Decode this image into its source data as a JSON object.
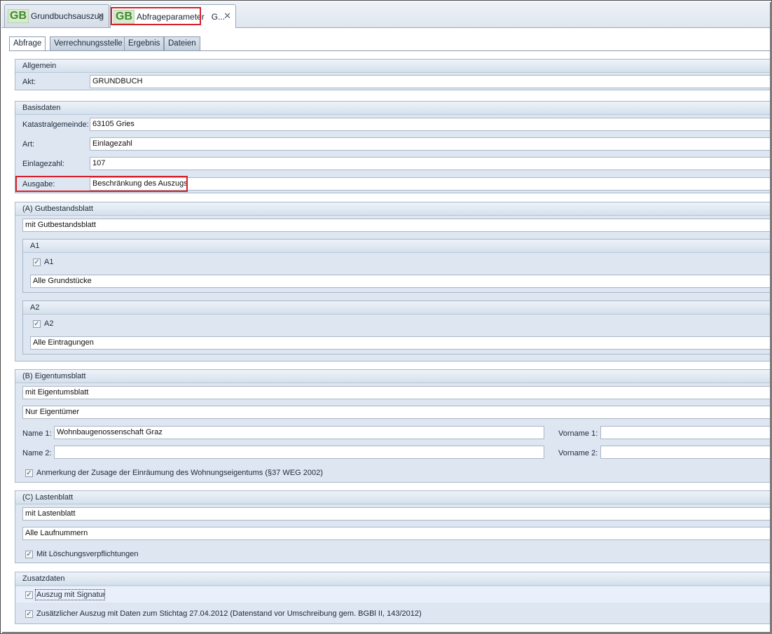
{
  "doc_tabs": [
    {
      "label": "Grundbuchsauszug",
      "icon": "gb-logo-icon",
      "close": "✕"
    },
    {
      "label": "Abfrageparameter",
      "suffix": "G...",
      "icon": "gb-logo-icon",
      "close": "✕"
    }
  ],
  "gb_logo_text": "GB",
  "inner_tabs": [
    "Abfrage",
    "Verrechnungsstelle",
    "Ergebnis",
    "Dateien"
  ],
  "allgemein": {
    "title": "Allgemein",
    "akt_label": "Akt:",
    "akt_value": "GRUNDBUCH"
  },
  "basisdaten": {
    "title": "Basisdaten",
    "kg_label": "Katastralgemeinde:",
    "kg_value": "63105 Gries",
    "art_label": "Art:",
    "art_value": "Einlagezahl",
    "ez_label": "Einlagezahl:",
    "ez_value": "107",
    "ausgabe_label": "Ausgabe:",
    "ausgabe_value": "Beschränkung des Auszugs"
  },
  "gutbestand": {
    "title": "(A) Gutbestandsblatt",
    "select": "mit Gutbestandsblatt",
    "a1": {
      "title": "A1",
      "check_label": "A1",
      "checked": true,
      "select": "Alle Grundstücke"
    },
    "a2": {
      "title": "A2",
      "check_label": "A2",
      "checked": true,
      "select": "Alle Eintragungen"
    }
  },
  "eigentum": {
    "title": "(B) Eigentumsblatt",
    "select1": "mit Eigentumsblatt",
    "select2": "Nur Eigentümer",
    "name1_label": "Name 1:",
    "name1_value": "Wohnbaugenossenschaft Graz",
    "vorname1_label": "Vorname 1:",
    "vorname1_value": "",
    "name2_label": "Name 2:",
    "name2_value": "",
    "vorname2_label": "Vorname 2:",
    "vorname2_value": "",
    "anmerkung_label": "Anmerkung der Zusage der Einräumung des Wohnungseigentums (§37 WEG 2002)",
    "anmerkung_checked": true
  },
  "lasten": {
    "title": "(C) Lastenblatt",
    "select1": "mit Lastenblatt",
    "select2": "Alle Laufnummern",
    "loesch_label": "Mit Löschungsverpflichtungen",
    "loesch_checked": true
  },
  "zusatz": {
    "title": "Zusatzdaten",
    "signatur_label": "Auszug mit Signatur",
    "signatur_checked": true,
    "stichtag_label": "Zusätzlicher Auszug mit Daten zum Stichtag 27.04.2012 (Datenstand vor Umschreibung gem. BGBl II, 143/2012)",
    "stichtag_checked": true
  },
  "check_glyph": "✓",
  "colors": {
    "highlight_red": "#d6202a",
    "group_bg": "#dde6f1",
    "logo_green": "#3f8a2e"
  }
}
